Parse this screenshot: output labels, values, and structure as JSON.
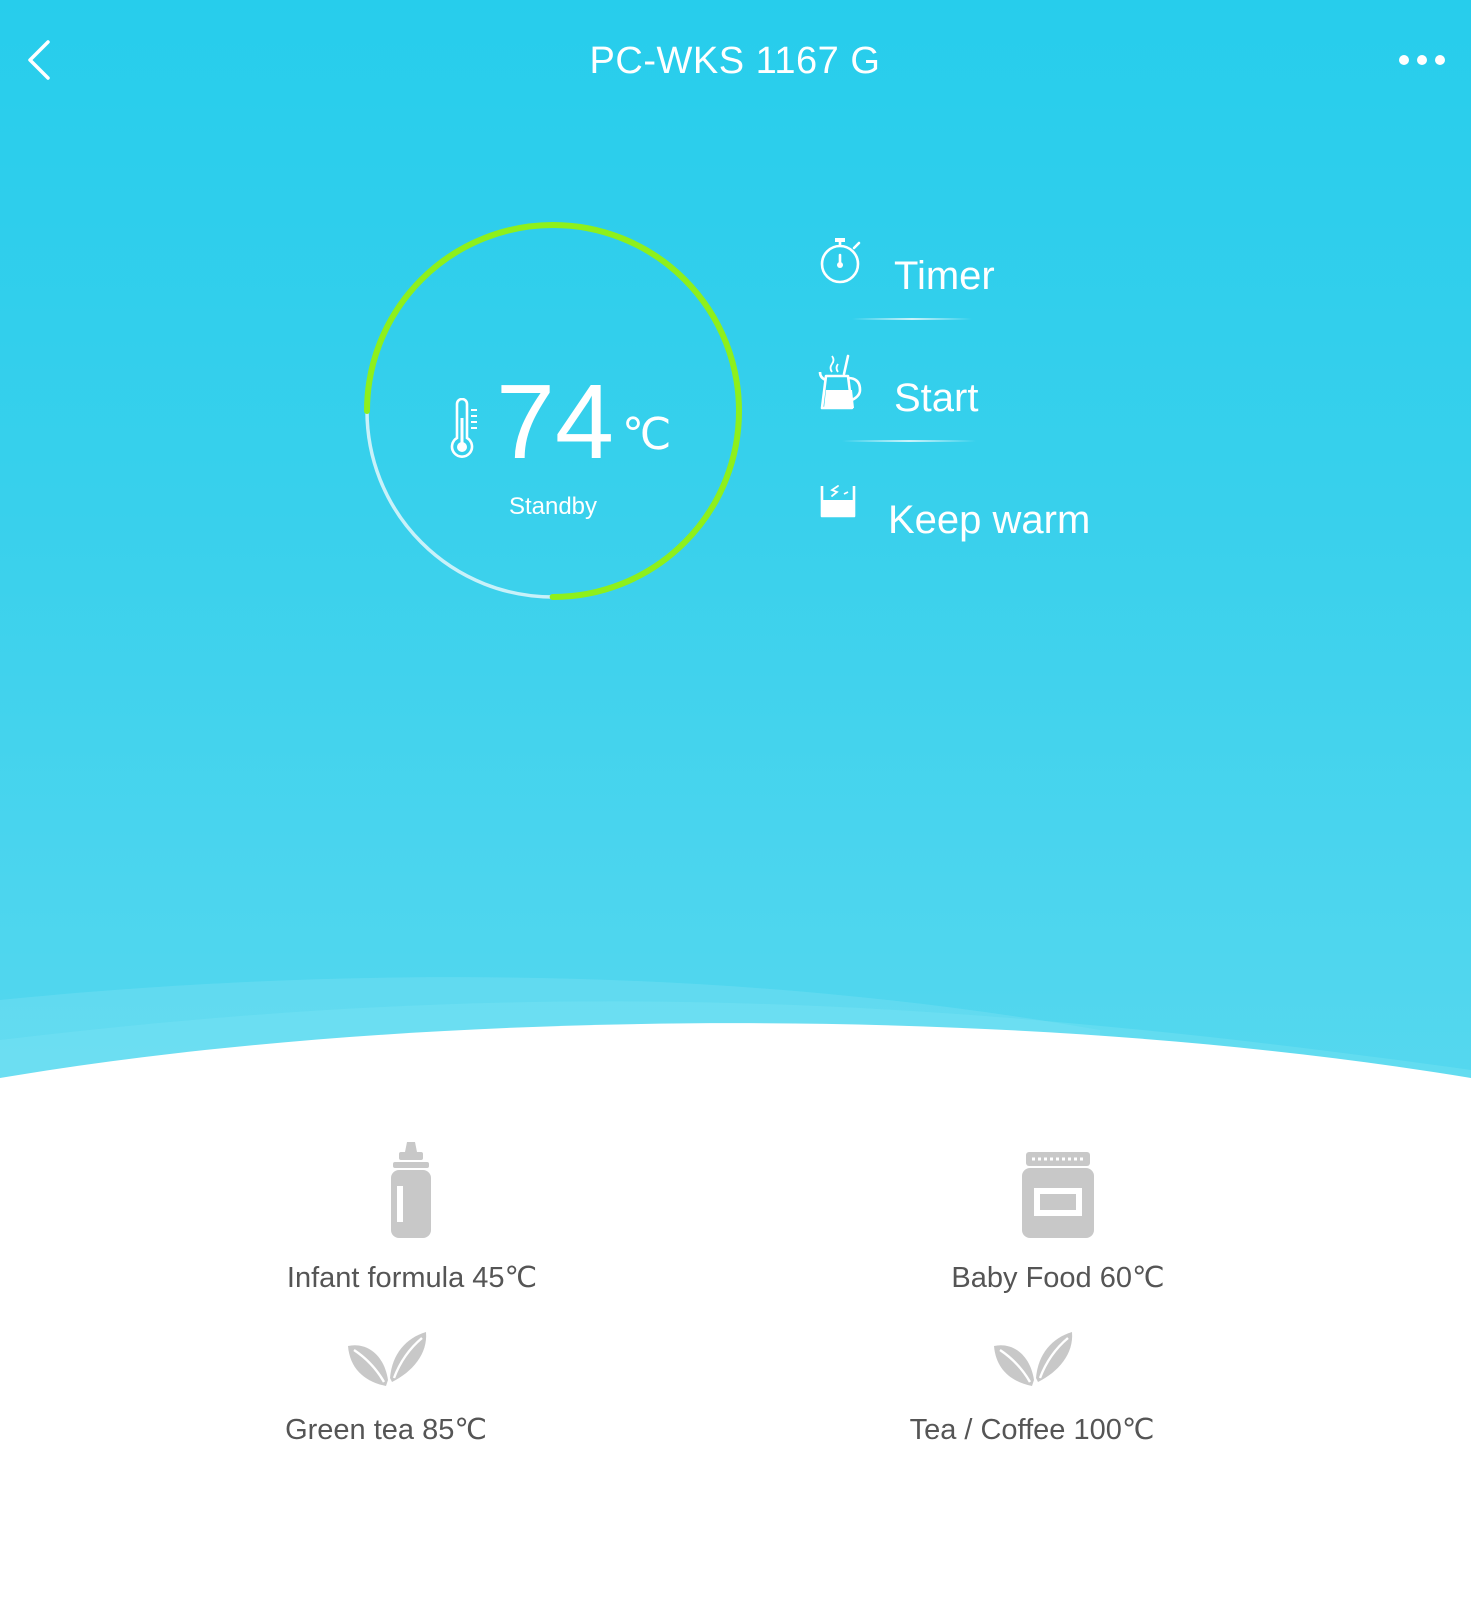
{
  "header": {
    "title": "PC-WKS 1167 G",
    "back_icon": "chevron-left-icon",
    "more_icon": "more-horizontal-icon"
  },
  "dial": {
    "temperature": "74",
    "unit": "℃",
    "status": "Standby",
    "progress_fraction": 0.75,
    "arc_color": "#8ef01b",
    "track_color": "#c8f1f9"
  },
  "actions": [
    {
      "label": "Timer",
      "icon": "stopwatch-icon"
    },
    {
      "label": "Start",
      "icon": "kettle-icon"
    },
    {
      "label": "Keep warm",
      "icon": "keep-warm-icon"
    }
  ],
  "presets": [
    {
      "label": "Infant formula 45℃",
      "icon": "baby-bottle-icon"
    },
    {
      "label": "Baby Food 60℃",
      "icon": "food-jar-icon"
    },
    {
      "label": "Green tea 85℃",
      "icon": "tea-leaf-icon"
    },
    {
      "label": "Tea / Coffee 100℃",
      "icon": "tea-leaf-icon"
    }
  ],
  "colors": {
    "background_top": "#27cdec",
    "background_bottom": "#57d8ef",
    "preset_icon": "#c8c8c8",
    "preset_text": "#555555"
  }
}
